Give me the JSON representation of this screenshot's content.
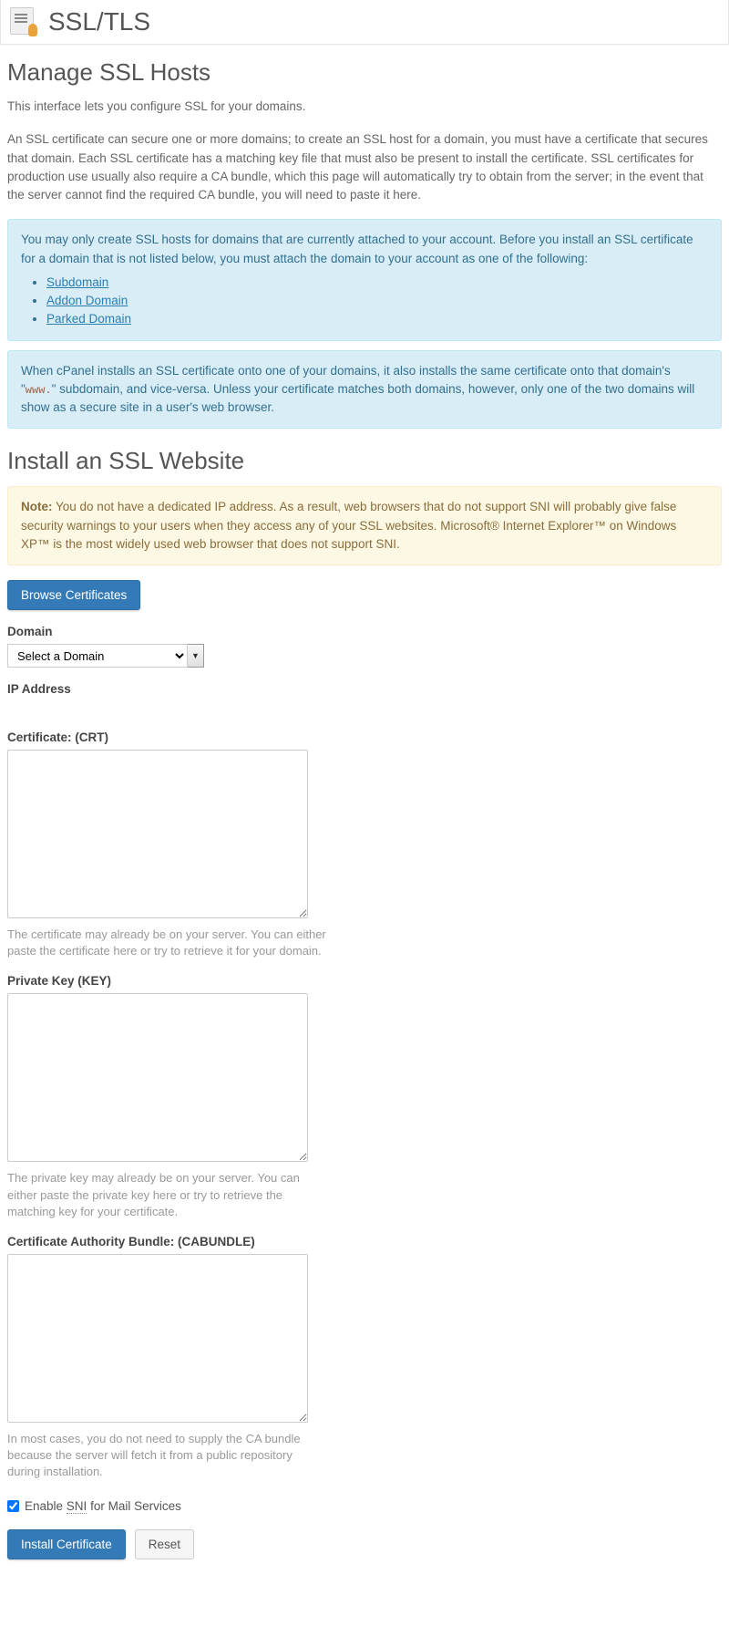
{
  "header": {
    "title": "SSL/TLS"
  },
  "manage": {
    "heading": "Manage SSL Hosts",
    "intro": "This interface lets you configure SSL for your domains.",
    "description": "An SSL certificate can secure one or more domains; to create an SSL host for a domain, you must have a certificate that secures that domain. Each SSL certificate has a matching key file that must also be present to install the certificate. SSL certificates for production use usually also require a CA bundle, which this page will automatically try to obtain from the server; in the event that the server cannot find the required CA bundle, you will need to paste it here."
  },
  "info1": {
    "text": "You may only create SSL hosts for domains that are currently attached to your account. Before you install an SSL certificate for a domain that is not listed below, you must attach the domain to your account as one of the following:",
    "links": [
      "Subdomain",
      "Addon Domain",
      "Parked Domain"
    ]
  },
  "info2": {
    "pre": "When cPanel installs an SSL certificate onto one of your domains, it also installs the same certificate onto that domain's \"",
    "mono": "www.",
    "post": "\" subdomain, and vice-versa. Unless your certificate matches both domains, however, only one of the two domains will show as a secure site in a user's web browser."
  },
  "install": {
    "heading": "Install an SSL Website",
    "note_label": "Note:",
    "note_text": " You do not have a dedicated IP address. As a result, web browsers that do not support SNI will probably give false security warnings to your users when they access any of your SSL websites. Microsoft® Internet Explorer™ on Windows XP™ is the most widely used web browser that does not support SNI.",
    "browse_btn": "Browse Certificates"
  },
  "form": {
    "domain_label": "Domain",
    "domain_placeholder": "Select a Domain",
    "ip_label": "IP Address",
    "crt_label": "Certificate: (CRT)",
    "crt_help": "The certificate may already be on your server. You can either paste the certificate here or try to retrieve it for your domain.",
    "key_label": "Private Key (KEY)",
    "key_help": "The private key may already be on your server. You can either paste the private key here or try to retrieve the matching key for your certificate.",
    "ca_label": "Certificate Authority Bundle: (CABUNDLE)",
    "ca_help": "In most cases, you do not need to supply the CA bundle because the server will fetch it from a public repository during installation.",
    "sni_pre": "Enable ",
    "sni_mid": "SNI",
    "sni_post": " for Mail Services",
    "install_btn": "Install Certificate",
    "reset_btn": "Reset"
  }
}
